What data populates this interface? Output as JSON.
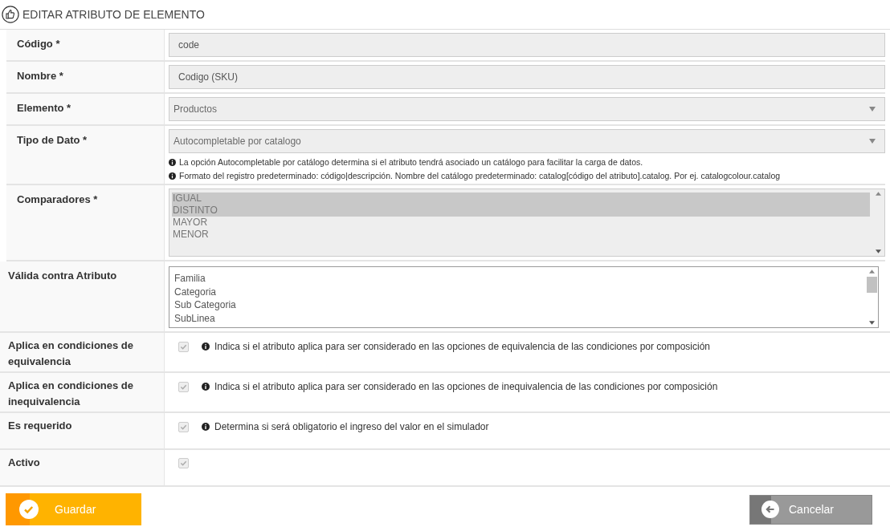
{
  "title": "EDITAR ATRIBUTO DE ELEMENTO",
  "fields": [
    {
      "kind": "text",
      "label": "Código *",
      "value": "code"
    },
    {
      "kind": "text",
      "label": "Nombre *",
      "value": "Codigo (SKU)"
    },
    {
      "kind": "select",
      "label": "Elemento *",
      "value": "Productos"
    },
    {
      "kind": "select",
      "label": "Tipo de Dato *",
      "value": "Autocompletable por catalogo",
      "hints": [
        "La opción Autocompletable por catálogo determina si el atributo tendrá asociado un catálogo para facilitar la carga de datos.",
        "Formato del registro predeterminado: código|descripción. Nombre del catálogo predeterminado: catalog[código del atributo].catalog. Por ej. catalogcolour.catalog"
      ]
    },
    {
      "kind": "multiselect",
      "label": "Comparadores *",
      "options": [
        {
          "label": "IGUAL",
          "selected": true
        },
        {
          "label": "DISTINTO",
          "selected": true
        },
        {
          "label": "MAYOR",
          "selected": false
        },
        {
          "label": "MENOR",
          "selected": false
        }
      ]
    },
    {
      "kind": "listbox",
      "label": "Válida contra Atributo",
      "options": [
        {
          "label": "Familia",
          "selected": false
        },
        {
          "label": "Categoria",
          "selected": false
        },
        {
          "label": "Sub Categoria",
          "selected": false
        },
        {
          "label": "SubLinea",
          "selected": false
        }
      ]
    },
    {
      "kind": "checkbox",
      "label": "Aplica en condiciones de equivalencia",
      "checked": true,
      "hint": "Indica si el atributo aplica para ser considerado en las opciones de equivalencia de las condiciones por composición"
    },
    {
      "kind": "checkbox",
      "label": "Aplica en condiciones de inequivalencia",
      "checked": true,
      "hint": "Indica si el atributo aplica para ser considerado en las opciones de inequivalencia de las condiciones por composición"
    },
    {
      "kind": "checkbox",
      "label": "Es requerido",
      "checked": true,
      "hint": "Determina si será obligatorio el ingreso del valor en el simulador"
    },
    {
      "kind": "checkbox",
      "label": "Activo",
      "checked": true
    }
  ],
  "buttons": {
    "save": "Guardar",
    "cancel": "Cancelar"
  }
}
